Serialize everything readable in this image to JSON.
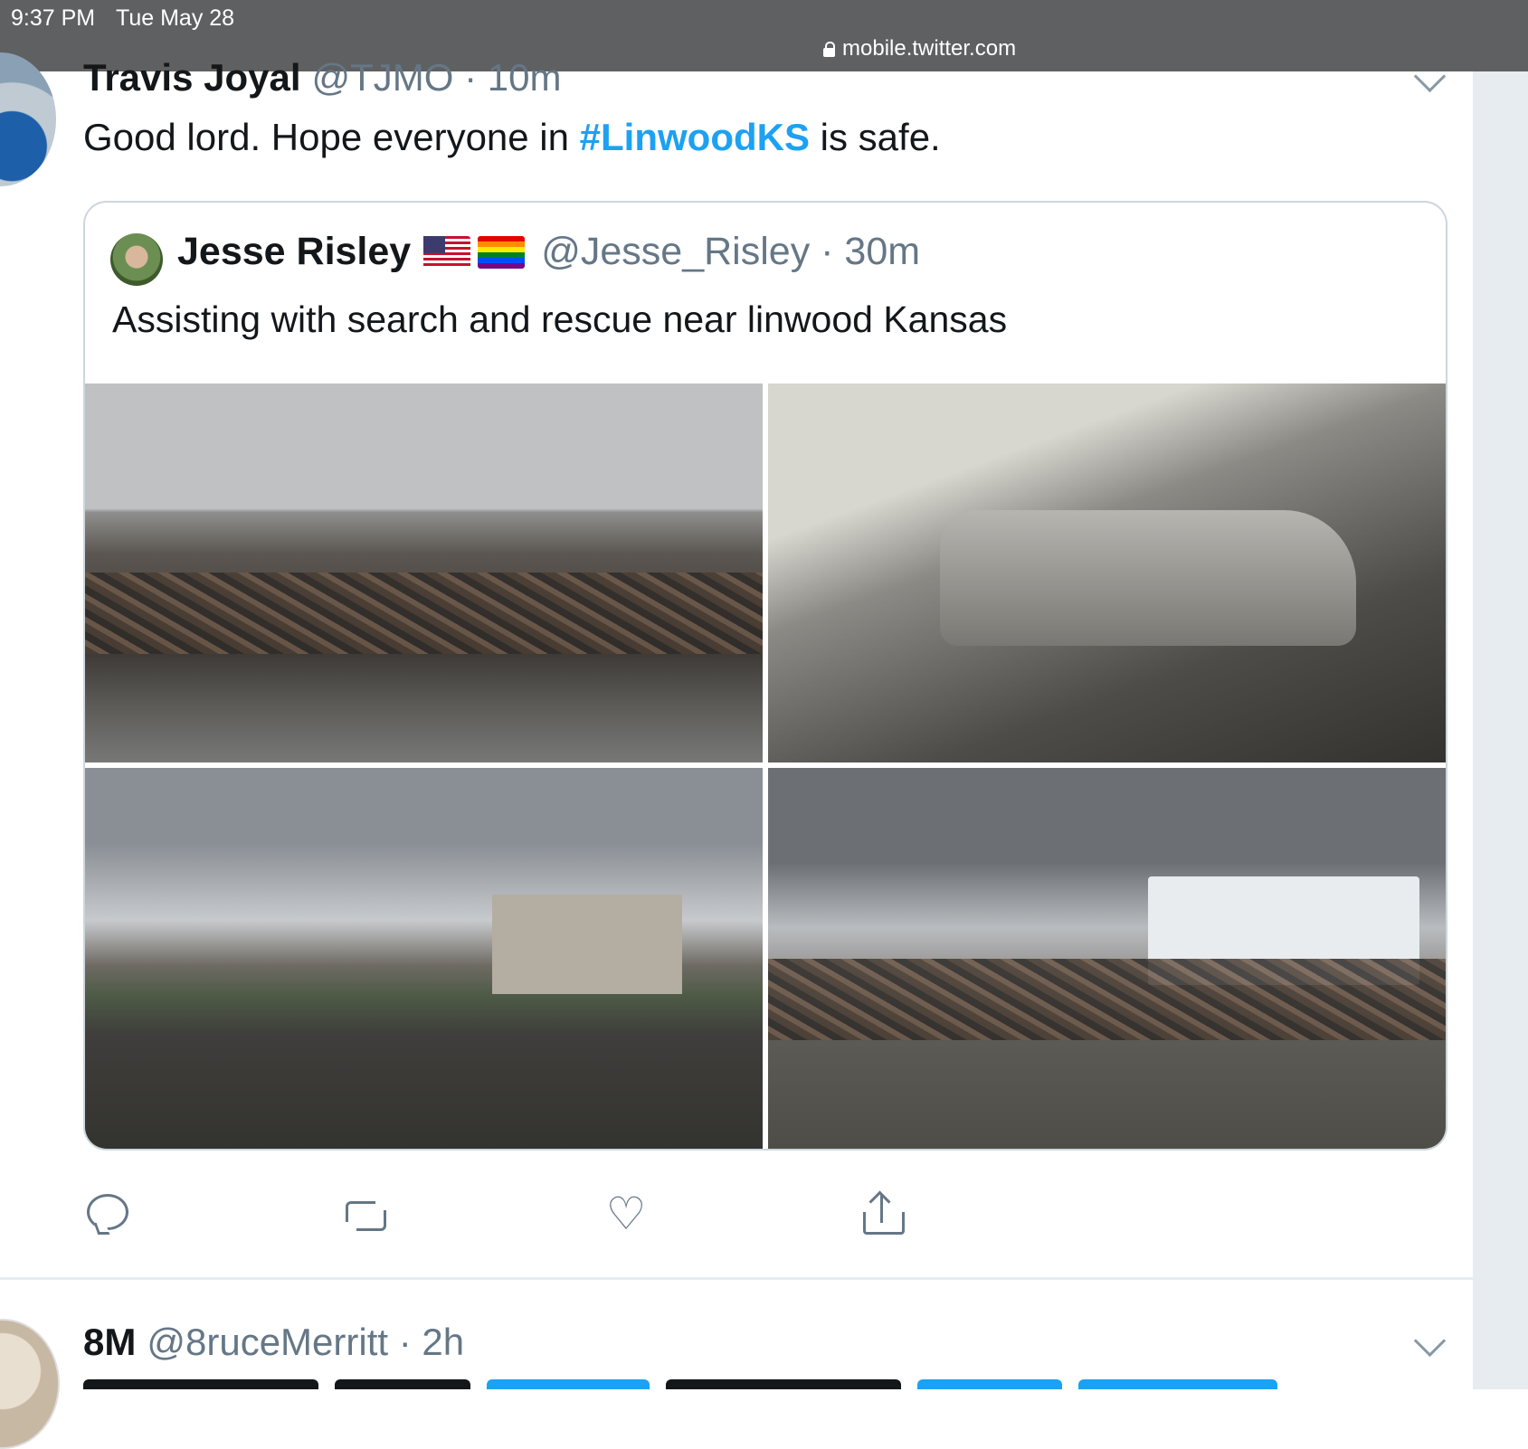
{
  "status_bar": {
    "time": "9:37 PM",
    "date": "Tue May 28",
    "url": "mobile.twitter.com"
  },
  "tweet1": {
    "name": "Travis Joyal",
    "meta": "@TJMO · 10m",
    "text_before": "Good lord. Hope everyone in ",
    "hashtag": "#LinwoodKS",
    "text_after": " is safe."
  },
  "quote": {
    "name": "Jesse Risley",
    "meta": "@Jesse_Risley · 30m",
    "text": "Assisting with search and rescue near linwood Kansas",
    "flags": [
      "us-flag-icon",
      "rainbow-flag-icon"
    ]
  },
  "actions": [
    "reply-icon",
    "retweet-icon",
    "heart-icon",
    "share-icon"
  ],
  "tweet2": {
    "name": "8M",
    "meta": "@8ruceMerritt · 2h"
  }
}
